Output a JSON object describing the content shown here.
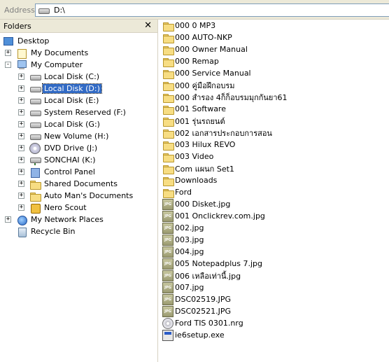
{
  "address": {
    "label": "Address",
    "value": "D:\\"
  },
  "folders": {
    "title": "Folders",
    "close_glyph": "✕",
    "tree": [
      {
        "label": "Desktop",
        "icon": "desktop-icon",
        "expander": "",
        "level": 0,
        "selected": false
      },
      {
        "label": "My Documents",
        "icon": "my-documents-icon",
        "expander": "+",
        "level": 1,
        "selected": false
      },
      {
        "label": "My Computer",
        "icon": "my-computer-icon",
        "expander": "-",
        "level": 1,
        "selected": false
      },
      {
        "label": "Local Disk (C:)",
        "icon": "drive-icon",
        "expander": "+",
        "level": 2,
        "selected": false
      },
      {
        "label": "Local Disk (D:)",
        "icon": "drive-icon",
        "expander": "+",
        "level": 2,
        "selected": true
      },
      {
        "label": "Local Disk (E:)",
        "icon": "drive-icon",
        "expander": "+",
        "level": 2,
        "selected": false
      },
      {
        "label": "System Reserved (F:)",
        "icon": "drive-icon",
        "expander": "+",
        "level": 2,
        "selected": false
      },
      {
        "label": "Local Disk (G:)",
        "icon": "drive-icon",
        "expander": "+",
        "level": 2,
        "selected": false
      },
      {
        "label": "New Volume (H:)",
        "icon": "drive-icon",
        "expander": "+",
        "level": 2,
        "selected": false
      },
      {
        "label": "DVD Drive (J:)",
        "icon": "dvd-drive-icon",
        "expander": "+",
        "level": 2,
        "selected": false
      },
      {
        "label": "SONCHAI (K:)",
        "icon": "network-drive-icon",
        "expander": "+",
        "level": 2,
        "selected": false
      },
      {
        "label": "Control Panel",
        "icon": "control-panel-icon",
        "expander": "+",
        "level": 2,
        "selected": false
      },
      {
        "label": "Shared Documents",
        "icon": "folder-icon",
        "expander": "+",
        "level": 2,
        "selected": false
      },
      {
        "label": "Auto Man's Documents",
        "icon": "folder-icon",
        "expander": "+",
        "level": 2,
        "selected": false
      },
      {
        "label": "Nero Scout",
        "icon": "nero-scout-icon",
        "expander": "+",
        "level": 2,
        "selected": false
      },
      {
        "label": "My Network Places",
        "icon": "network-places-icon",
        "expander": "+",
        "level": 1,
        "selected": false
      },
      {
        "label": "Recycle Bin",
        "icon": "recycle-bin-icon",
        "expander": "",
        "level": 1,
        "selected": false
      }
    ]
  },
  "files": [
    {
      "name": "000 0 MP3",
      "icon": "folder-icon"
    },
    {
      "name": "000 AUTO-NKP",
      "icon": "folder-icon"
    },
    {
      "name": "000 Owner Manual",
      "icon": "folder-icon"
    },
    {
      "name": "000 Remap",
      "icon": "folder-icon"
    },
    {
      "name": "000 Service Manual",
      "icon": "folder-icon"
    },
    {
      "name": "000 คู่มือฝึกอบรม",
      "icon": "folder-icon"
    },
    {
      "name": "000 สำรอง 4ก็ก็อบรมมุกกันยา61",
      "icon": "folder-icon"
    },
    {
      "name": "001 Software",
      "icon": "folder-icon"
    },
    {
      "name": "001 รุ่นรถยนต์",
      "icon": "folder-icon"
    },
    {
      "name": "002 เอกสารประกอบการสอน",
      "icon": "folder-icon"
    },
    {
      "name": "003 Hilux REVO",
      "icon": "folder-icon"
    },
    {
      "name": "003 Video",
      "icon": "folder-icon"
    },
    {
      "name": "Com แผนก Set1",
      "icon": "folder-icon"
    },
    {
      "name": "Downloads",
      "icon": "folder-icon"
    },
    {
      "name": "Ford",
      "icon": "folder-icon"
    },
    {
      "name": "000 Disket.jpg",
      "icon": "jpg-file-icon"
    },
    {
      "name": "001 Onclickrev.com.jpg",
      "icon": "jpg-file-icon"
    },
    {
      "name": "002.jpg",
      "icon": "jpg-file-icon"
    },
    {
      "name": "003.jpg",
      "icon": "jpg-file-icon"
    },
    {
      "name": "004.jpg",
      "icon": "jpg-file-icon"
    },
    {
      "name": "005 Notepadplus 7.jpg",
      "icon": "jpg-file-icon"
    },
    {
      "name": "006 เหลือเท่านี้.jpg",
      "icon": "jpg-file-icon"
    },
    {
      "name": "007.jpg",
      "icon": "jpg-file-icon"
    },
    {
      "name": "DSC02519.JPG",
      "icon": "jpg-file-icon"
    },
    {
      "name": "DSC02521.JPG",
      "icon": "jpg-file-icon"
    },
    {
      "name": "Ford TIS 0301.nrg",
      "icon": "nrg-disc-image-icon"
    },
    {
      "name": "ie6setup.exe",
      "icon": "exe-file-icon"
    }
  ]
}
